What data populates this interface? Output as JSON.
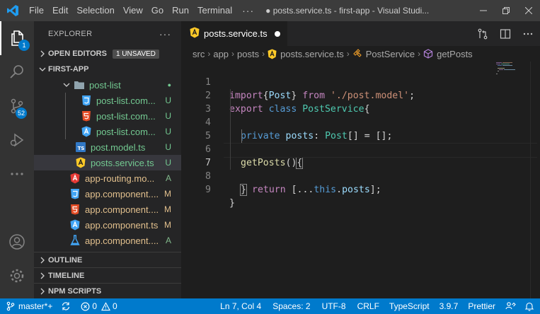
{
  "titlebar": {
    "menu": [
      "File",
      "Edit",
      "Selection",
      "View",
      "Go",
      "Run",
      "Terminal"
    ],
    "more": "···",
    "title": "● posts.service.ts - first-app - Visual Studi..."
  },
  "activity": {
    "explorer_badge": "1",
    "scm_badge": "52"
  },
  "sidebar": {
    "title": "EXPLORER",
    "more": "···",
    "open_editors": "OPEN EDITORS",
    "unsaved": "1 UNSAVED",
    "project": "FIRST-APP",
    "tree": [
      {
        "name": "post-list",
        "status": "●",
        "kind": "folder"
      },
      {
        "name": "post-list.com...",
        "status": "U",
        "kind": "css"
      },
      {
        "name": "post-list.com...",
        "status": "U",
        "kind": "html"
      },
      {
        "name": "post-list.com...",
        "status": "U",
        "kind": "angular"
      },
      {
        "name": "post.model.ts",
        "status": "U",
        "kind": "ts"
      },
      {
        "name": "posts.service.ts",
        "status": "U",
        "kind": "angular-yellow"
      },
      {
        "name": "app-routing.mo...",
        "status": "A",
        "kind": "angular-red"
      },
      {
        "name": "app.component....",
        "status": "M",
        "kind": "css"
      },
      {
        "name": "app.component....",
        "status": "M",
        "kind": "html"
      },
      {
        "name": "app.component.ts",
        "status": "M",
        "kind": "angular"
      },
      {
        "name": "app.component....",
        "status": "A",
        "kind": "flask"
      }
    ],
    "outline": "OUTLINE",
    "timeline": "TIMELINE",
    "npm": "NPM SCRIPTS"
  },
  "editor": {
    "tab_label": "posts.service.ts",
    "breadcrumb": [
      "src",
      "app",
      "posts",
      "posts.service.ts",
      "PostService",
      "getPosts"
    ],
    "lines": [
      "1",
      "2",
      "3",
      "4",
      "5",
      "6",
      "7",
      "8",
      "9"
    ],
    "code": {
      "l1_import": "import",
      "l1_brace_open": "{",
      "l1_post": "Post",
      "l1_brace_close": "}",
      "l1_from": " from ",
      "l1_str": "'./post.model'",
      "l1_semi": ";",
      "l2_export": "export",
      "l2_class": " class ",
      "l2_name": "PostService",
      "l2_brace": "{",
      "l3_private": "private",
      "l3_prop": " posts",
      "l3_colon": ": ",
      "l3_type": "Post",
      "l3_rest": "[] = [];",
      "l5_fn": "getPosts",
      "l5_paren": "()",
      "l5_brace": "{",
      "l6_return": "return",
      "l6_spread": " [...",
      "l6_this": "this",
      "l6_dot": ".",
      "l6_posts": "posts",
      "l6_end": "];",
      "l7_brace": "}",
      "l9_brace": "}"
    }
  },
  "statusbar": {
    "branch": "master*+",
    "errors": "0",
    "warnings": "0",
    "position": "Ln 7, Col 4",
    "spaces": "Spaces: 2",
    "encoding": "UTF-8",
    "eol": "CRLF",
    "language": "TypeScript",
    "version": "3.9.7",
    "prettier": "Prettier"
  },
  "colors": {
    "accent": "#007acc",
    "titlebar": "#3c3c3c",
    "activitybar": "#333333",
    "sidebar": "#252526",
    "editor": "#1e1e1e"
  }
}
